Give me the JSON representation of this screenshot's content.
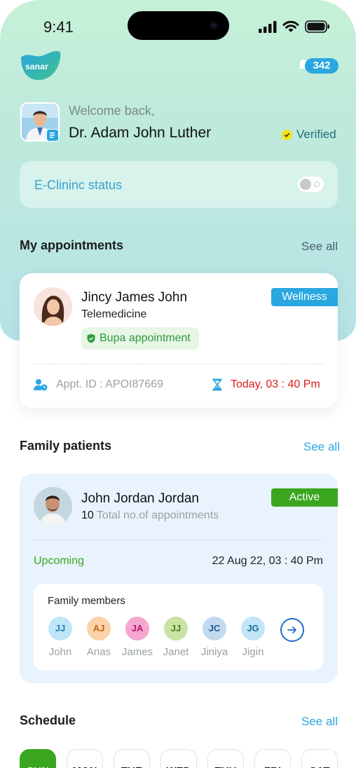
{
  "status_bar": {
    "time": "9:41"
  },
  "brand": {
    "logo_text": "sanar"
  },
  "notifications": {
    "count": "342"
  },
  "profile": {
    "welcome": "Welcome back,",
    "name": "Dr. Adam John Luther",
    "verified_label": "Verified"
  },
  "eclinic": {
    "label": "E-Clininc status",
    "enabled": false
  },
  "appointments": {
    "title": "My appointments",
    "see_all": "See all",
    "card": {
      "patient_name": "Jincy James John",
      "type": "Telemedicine",
      "insurance": "Bupa appointment",
      "tag": "Wellness",
      "appt_id": "Appt. ID : APOI87669",
      "time": "Today, 03 : 40 Pm"
    }
  },
  "family": {
    "title": "Family patients",
    "see_all": "See all",
    "card": {
      "patient_name": "John Jordan Jordan",
      "total_count": "10",
      "total_label": "Total no.of appointments",
      "status": "Active",
      "upcoming_label": "Upcoming",
      "upcoming_date": "22 Aug 22, 03 : 40 Pm",
      "members_title": "Family members",
      "members": [
        {
          "initials": "JJ",
          "name": "John",
          "bg": "#bfe6f7",
          "fg": "#1f7fb5"
        },
        {
          "initials": "AJ",
          "name": "Anas",
          "bg": "#fbd3a8",
          "fg": "#c4620e"
        },
        {
          "initials": "JA",
          "name": "James",
          "bg": "#f6a7cf",
          "fg": "#b51873"
        },
        {
          "initials": "JJ",
          "name": "Janet",
          "bg": "#c9e3a4",
          "fg": "#4e7d16"
        },
        {
          "initials": "JC",
          "name": "Jiniya",
          "bg": "#c2d9ef",
          "fg": "#245a8c"
        },
        {
          "initials": "JG",
          "name": "Jigin",
          "bg": "#c3e5f6",
          "fg": "#1a6d9c"
        }
      ]
    }
  },
  "schedule": {
    "title": "Schedule",
    "see_all": "See all",
    "days": [
      "SUN",
      "MON",
      "TUE",
      "WED",
      "THU",
      "FRI",
      "SAT"
    ],
    "selected_day": "SUN"
  },
  "colors": {
    "brand_blue": "#2aa6e0",
    "active_green": "#3aa61f",
    "alert_red": "#e11b1b"
  }
}
